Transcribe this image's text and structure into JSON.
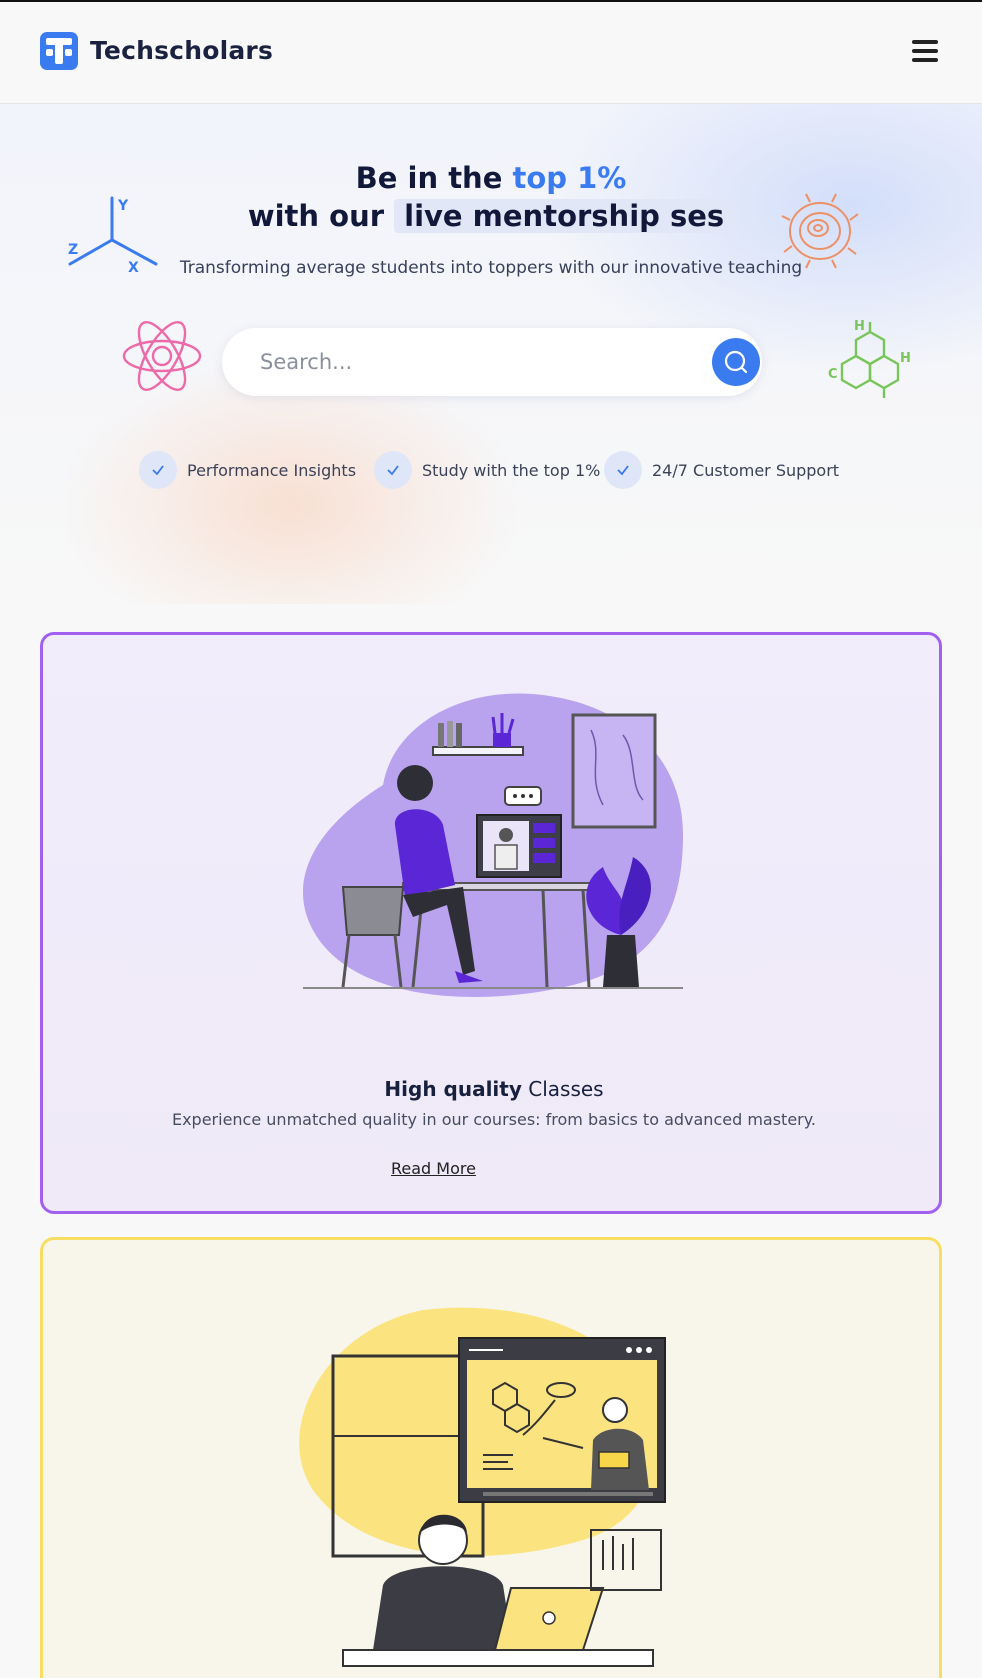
{
  "header": {
    "brand": "Techscholars",
    "logo_icon": "techscholars-logo-icon",
    "menu_icon": "hamburger-menu-icon"
  },
  "hero": {
    "headline_prefix": "Be in the ",
    "headline_accent": "top 1%",
    "headline_line2_prefix": "with our ",
    "headline_highlight": "live mentorship ses",
    "subtitle": "Transforming average students into toppers with our innovative teaching"
  },
  "search": {
    "placeholder": "Search...",
    "value": "",
    "button_icon": "search-icon"
  },
  "features": [
    {
      "label": "Performance Insights",
      "icon": "check-icon"
    },
    {
      "label": "Study with the top 1%",
      "icon": "check-icon"
    },
    {
      "label": "24/7 Customer Support",
      "icon": "check-icon"
    }
  ],
  "cards": [
    {
      "title_bold": "High quality",
      "title_rest": " Classes",
      "description": "Experience unmatched quality in our courses: from basics to advanced mastery.",
      "link": "Read More",
      "accent": "#a160f0"
    },
    {
      "accent": "#f7de62"
    }
  ],
  "colors": {
    "primary": "#3b7bf0",
    "text_dark": "#14203b",
    "purple_card": "#a160f0",
    "yellow_card": "#f7de62"
  }
}
